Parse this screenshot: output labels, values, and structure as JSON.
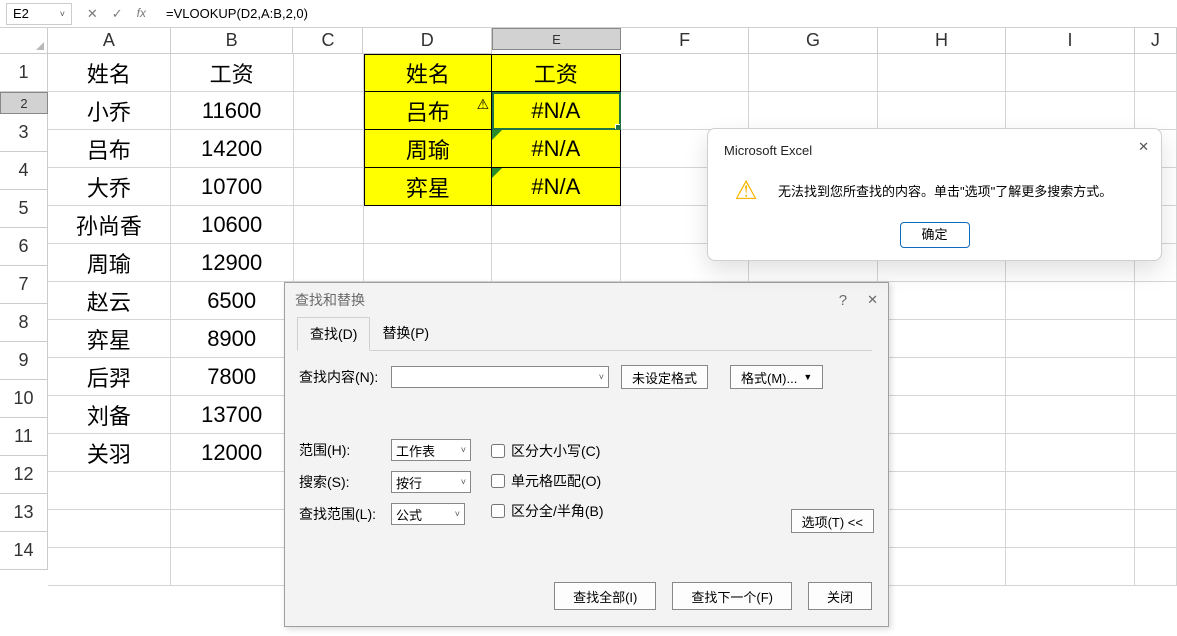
{
  "formula_bar": {
    "name_box": "E2",
    "cancel_icon": "✕",
    "confirm_icon": "✓",
    "fx_label": "fx",
    "dropdown_icon": "˅",
    "formula": "=VLOOKUP(D2,A:B,2,0)"
  },
  "columns": [
    "A",
    "B",
    "C",
    "D",
    "E",
    "F",
    "G",
    "H",
    "I",
    "J"
  ],
  "rows": [
    1,
    2,
    3,
    4,
    5,
    6,
    7,
    8,
    9,
    10,
    11,
    12,
    13,
    14
  ],
  "width_classes": [
    "wA",
    "wB",
    "wC",
    "wD",
    "wE",
    "wF",
    "wG",
    "wH",
    "wI",
    "wJ"
  ],
  "selected_col": "E",
  "selected_row": 2,
  "header": {
    "a": "姓名",
    "b": "工资",
    "d": "姓名",
    "e": "工资"
  },
  "table_ab": [
    {
      "name": "小乔",
      "salary": "11600"
    },
    {
      "name": "吕布",
      "salary": "14200"
    },
    {
      "name": "大乔",
      "salary": "10700"
    },
    {
      "name": "孙尚香",
      "salary": "10600"
    },
    {
      "name": "周瑜",
      "salary": "12900"
    },
    {
      "name": "赵云",
      "salary": "6500"
    },
    {
      "name": "弈星",
      "salary": "8900"
    },
    {
      "name": "后羿",
      "salary": "7800"
    },
    {
      "name": "刘备",
      "salary": "13700"
    },
    {
      "name": "关羽",
      "salary": "12000"
    }
  ],
  "table_de": [
    {
      "name": "吕布",
      "salary": "#N/A",
      "warn": true
    },
    {
      "name": "周瑜",
      "salary": "#N/A",
      "tri": true
    },
    {
      "name": "弈星",
      "salary": "#N/A",
      "tri": true
    }
  ],
  "find_dialog": {
    "title": "查找和替换",
    "help_icon": "?",
    "close_icon": "✕",
    "tab_find": "查找(D)",
    "tab_replace": "替换(P)",
    "find_label": "查找内容(N):",
    "find_value": "",
    "no_format": "未设定格式",
    "format_btn": "格式(M)...",
    "scope_label": "范围(H):",
    "scope_value": "工作表",
    "search_label": "搜索(S):",
    "search_value": "按行",
    "lookin_label": "查找范围(L):",
    "lookin_value": "公式",
    "cb_case": "区分大小写(C)",
    "cb_whole": "单元格匹配(O)",
    "cb_width": "区分全/半角(B)",
    "options_btn": "选项(T) <<",
    "find_all": "查找全部(I)",
    "find_next": "查找下一个(F)",
    "close": "关闭"
  },
  "message_box": {
    "title": "Microsoft Excel",
    "close_icon": "✕",
    "text": "无法找到您所查找的内容。单击\"选项\"了解更多搜索方式。",
    "ok": "确定"
  }
}
